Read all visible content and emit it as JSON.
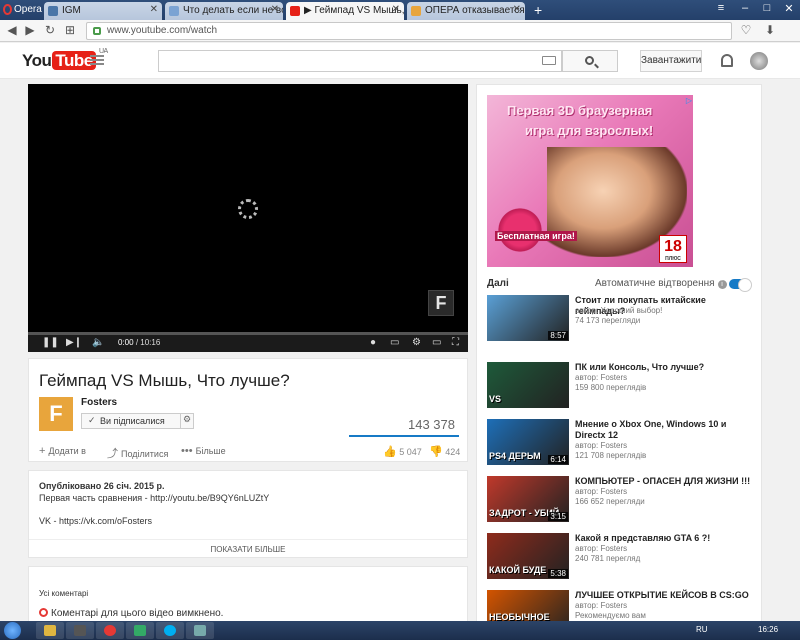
{
  "browser": {
    "menu_label": "Opera",
    "tabs": [
      {
        "label": "IGM",
        "favicon_color": "#4a76a8"
      },
      {
        "label": "Что делать если не восп",
        "favicon_color": "#7ba3d3"
      },
      {
        "label": "▶ Геймпад VS Мышь, Что",
        "favicon_color": "#e62117"
      },
      {
        "label": "ОПЕРА отказывается пок",
        "favicon_color": "#e8a53c"
      }
    ],
    "url": "www.youtube.com/watch"
  },
  "youtube": {
    "logo_you": "You",
    "logo_tube": "Tube",
    "region": "UA",
    "upload_label": "Завантажити",
    "search_placeholder": ""
  },
  "player": {
    "current_time": "0:00",
    "duration": "/ 10:16",
    "progress": 0.0,
    "brand_letter": "F"
  },
  "video": {
    "title": "Геймпад VS Мышь, Что лучше?",
    "channel": "Fosters",
    "subscribed_label": "Ви підписалися",
    "views": "143 378",
    "add_to_label": "Додати в",
    "share_label": "Поділитися",
    "more_label": "Більше",
    "likes": "5 047",
    "dislikes": "424"
  },
  "description": {
    "published": "Опубліковано 26 січ. 2015 р.",
    "line1": "Первая часть сравнения - http://youtu.be/B9QY6nLUZtY",
    "line2": "VK - https://vk.com/oFosters",
    "show_more": "ПОКАЗАТИ БІЛЬШЕ"
  },
  "comments": {
    "header": "Усі коментарі",
    "disabled_text": "Коментарі для цього відео вимкнено."
  },
  "ad": {
    "text_line1": "Первая 3D браузерная",
    "text_line2": "игра для взрослых!",
    "badge": "Бесплатная игра!",
    "age": "18",
    "age_sub": "ПЛЮС"
  },
  "sidebar": {
    "next_label": "Далі",
    "autoplay_label": "Автоматичне відтворення",
    "autoplay_on": true,
    "items": [
      {
        "title": "Стоит ли покупать китайские геймпады?",
        "channel": "автор: Хороший выбор!",
        "views": "74 173 перегляди",
        "duration": "8:57",
        "thumb_color": "#5aa0d6",
        "thumb_text": ""
      },
      {
        "title": "ПК или Консоль, Что лучше?",
        "channel": "автор: Fosters",
        "views": "159 800 переглядів",
        "duration": "",
        "thumb_color": "#1e5a3a",
        "thumb_text": "VS"
      },
      {
        "title": "Мнение о Xbox One, Windows 10 и Directx 12",
        "channel": "автор: Fosters",
        "views": "121 708 переглядів",
        "duration": "6:14",
        "thumb_color": "#1e6fb8",
        "thumb_text": "PS4 ДЕРЬМ"
      },
      {
        "title": "КОМПЬЮТЕР - ОПАСЕН ДЛЯ ЖИЗНИ !!!",
        "channel": "автор: Fosters",
        "views": "166 652 перегляди",
        "duration": "3:15",
        "thumb_color": "#c0392b",
        "thumb_text": "ЗАДРОТ - УБИЙ"
      },
      {
        "title": "Какой я представляю GTA 6 ?!",
        "channel": "автор: Fosters",
        "views": "240 781 перегляд",
        "duration": "5:38",
        "thumb_color": "#8e2b1c",
        "thumb_text": "КАКОЙ БУДЕ"
      },
      {
        "title": "ЛУЧШЕЕ ОТКРЫТИЕ КЕЙСОВ В CS:GO",
        "channel": "автор: Fosters",
        "views": "Рекомендуємо вам",
        "duration": "",
        "thumb_color": "#d35400",
        "thumb_text": "НЕОБЫЧНОЕ ОТКРЫТИЕ"
      }
    ]
  },
  "taskbar": {
    "language": "RU",
    "time": "16:26"
  }
}
